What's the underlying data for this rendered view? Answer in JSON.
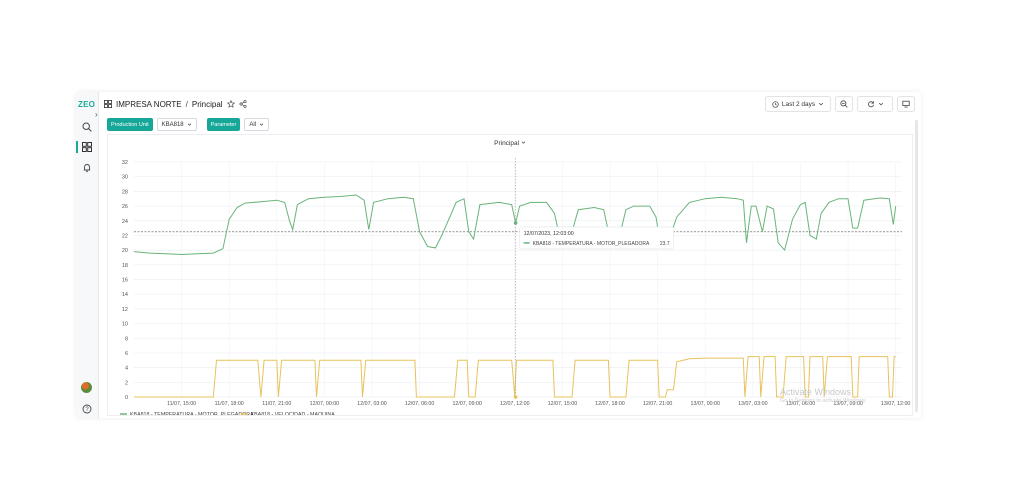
{
  "sidebar": {
    "logo": "ZEO",
    "expand_glyph": "›"
  },
  "header": {
    "dashboards_icon": "grid-icon",
    "title": "IMPRESA NORTE",
    "separator": "/",
    "page": "Principal",
    "time_range": "Last 2 days",
    "star_icon": "star-icon",
    "share_icon": "share-icon"
  },
  "filters": {
    "production_unit_label": "Production Unit",
    "production_unit_value": "KBA818",
    "parameter_label": "Parameter",
    "parameter_value": "All"
  },
  "panel": {
    "title": "Principal"
  },
  "tooltip": {
    "time": "12/07/2023, 12:03:00",
    "series": "KBA818 - TEMPERATURA - MOTOR_PLEGADORA",
    "value": "23.7"
  },
  "watermark": {
    "line1": "Activate Windows",
    "line2": "Go to Settings to activate Windows."
  },
  "chart_data": {
    "type": "line",
    "title": "Principal",
    "ylim": [
      0,
      32
    ],
    "yticks": [
      0,
      2,
      4,
      6,
      8,
      10,
      12,
      14,
      16,
      18,
      20,
      22,
      24,
      26,
      28,
      30,
      32
    ],
    "xticks": [
      "11/07, 15:00",
      "11/07, 18:00",
      "11/07, 21:00",
      "12/07, 00:00",
      "12/07, 03:00",
      "12/07, 06:00",
      "12/07, 09:00",
      "12/07, 12:00",
      "12/07, 15:00",
      "12/07, 18:00",
      "12/07, 21:00",
      "13/07, 00:00",
      "13/07, 03:00",
      "13/07, 06:00",
      "13/07, 09:00",
      "13/07, 12:00"
    ],
    "x_hours_from": "11/07, 12:00",
    "threshold": 22.5,
    "cursor_x": 24.05,
    "legend_position": "bottom-left",
    "grid": true,
    "series": [
      {
        "name": "KBA818 - TEMPERATURA - MOTOR_PLEGADORA",
        "color": "#6ab37a",
        "points": [
          [
            0,
            19.8
          ],
          [
            1,
            19.6
          ],
          [
            2,
            19.5
          ],
          [
            3,
            19.4
          ],
          [
            4,
            19.5
          ],
          [
            5,
            19.6
          ],
          [
            5.6,
            20.2
          ],
          [
            6,
            24.2
          ],
          [
            6.5,
            25.8
          ],
          [
            7,
            26.4
          ],
          [
            8,
            26.6
          ],
          [
            9,
            26.8
          ],
          [
            9.5,
            26.5
          ],
          [
            9.8,
            24.0
          ],
          [
            10.0,
            22.8
          ],
          [
            10.3,
            26.2
          ],
          [
            11,
            27.0
          ],
          [
            12,
            27.2
          ],
          [
            13,
            27.3
          ],
          [
            14,
            27.5
          ],
          [
            14.5,
            26.8
          ],
          [
            14.8,
            22.8
          ],
          [
            15.1,
            26.5
          ],
          [
            16,
            27.0
          ],
          [
            17,
            27.2
          ],
          [
            17.6,
            27.0
          ],
          [
            18,
            22.5
          ],
          [
            18.5,
            20.5
          ],
          [
            19,
            20.3
          ],
          [
            19.4,
            22.0
          ],
          [
            19.7,
            23.5
          ],
          [
            20.3,
            26.5
          ],
          [
            20.8,
            27.0
          ],
          [
            21.1,
            22.5
          ],
          [
            21.4,
            21.5
          ],
          [
            21.8,
            26.2
          ],
          [
            23,
            26.5
          ],
          [
            23.8,
            26.2
          ],
          [
            24.05,
            23.7
          ],
          [
            24.3,
            26.0
          ],
          [
            25,
            26.5
          ],
          [
            26,
            26.5
          ],
          [
            26.5,
            25.0
          ],
          [
            26.8,
            22.0
          ],
          [
            27.2,
            21.0
          ],
          [
            27.6,
            22.5
          ],
          [
            28,
            25.5
          ],
          [
            29,
            25.8
          ],
          [
            29.6,
            25.5
          ],
          [
            30,
            21.5
          ],
          [
            30.5,
            21.0
          ],
          [
            31,
            25.5
          ],
          [
            31.5,
            26.0
          ],
          [
            32.5,
            26.0
          ],
          [
            32.9,
            24.5
          ],
          [
            33.2,
            20.5
          ],
          [
            33.6,
            20.6
          ],
          [
            34.2,
            24.5
          ],
          [
            35,
            26.5
          ],
          [
            36,
            27.0
          ],
          [
            37,
            27.2
          ],
          [
            38,
            27.0
          ],
          [
            38.4,
            26.8
          ],
          [
            38.6,
            21.0
          ],
          [
            38.9,
            26.0
          ],
          [
            39.2,
            26.0
          ],
          [
            39.6,
            22.5
          ],
          [
            39.9,
            26.0
          ],
          [
            40.3,
            25.6
          ],
          [
            40.6,
            21.0
          ],
          [
            41,
            20.0
          ],
          [
            41.5,
            24.2
          ],
          [
            42,
            26.2
          ],
          [
            42.3,
            26.5
          ],
          [
            42.6,
            22.0
          ],
          [
            43,
            21.5
          ],
          [
            43.3,
            25.0
          ],
          [
            43.8,
            26.5
          ],
          [
            44.4,
            27.0
          ],
          [
            45,
            27.0
          ],
          [
            45.3,
            23.0
          ],
          [
            45.6,
            23.0
          ],
          [
            46,
            26.8
          ],
          [
            47,
            27.1
          ],
          [
            47.6,
            27.0
          ],
          [
            47.85,
            23.5
          ],
          [
            48,
            26.0
          ]
        ]
      },
      {
        "name": "KBA818 - VELOCIDAD - MAQUINA",
        "color": "#e8c35b",
        "points": [
          [
            0,
            0
          ],
          [
            4.9,
            0
          ],
          [
            5,
            0
          ],
          [
            5.2,
            5.0
          ],
          [
            7.8,
            5.0
          ],
          [
            8.0,
            0
          ],
          [
            8.2,
            5.0
          ],
          [
            9.0,
            5.0
          ],
          [
            9.1,
            0
          ],
          [
            9.3,
            5.0
          ],
          [
            11.4,
            5.0
          ],
          [
            11.5,
            0
          ],
          [
            11.7,
            5.0
          ],
          [
            14.3,
            5.0
          ],
          [
            14.4,
            0
          ],
          [
            14.6,
            5.0
          ],
          [
            17.7,
            5.0
          ],
          [
            17.8,
            0
          ],
          [
            20.2,
            0
          ],
          [
            20.4,
            5.0
          ],
          [
            21.0,
            5.0
          ],
          [
            21.1,
            0
          ],
          [
            21.5,
            0
          ],
          [
            21.7,
            5.0
          ],
          [
            23.8,
            5.0
          ],
          [
            24.0,
            0
          ],
          [
            24.1,
            5.0
          ],
          [
            26.4,
            5.0
          ],
          [
            26.5,
            0
          ],
          [
            27.6,
            0
          ],
          [
            27.8,
            5.0
          ],
          [
            29.9,
            5.0
          ],
          [
            30.0,
            0
          ],
          [
            31.0,
            0
          ],
          [
            31.2,
            5.0
          ],
          [
            33.0,
            5.0
          ],
          [
            33.1,
            0
          ],
          [
            33.5,
            0
          ],
          [
            33.6,
            1.0
          ],
          [
            34.0,
            1.0
          ],
          [
            34.2,
            4.8
          ],
          [
            35,
            5.2
          ],
          [
            36,
            5.3
          ],
          [
            37.3,
            5.3
          ],
          [
            38.4,
            5.3
          ],
          [
            38.5,
            0
          ],
          [
            38.7,
            5.5
          ],
          [
            39.4,
            5.5
          ],
          [
            39.5,
            0
          ],
          [
            39.7,
            5.5
          ],
          [
            40.4,
            5.5
          ],
          [
            40.5,
            0
          ],
          [
            40.9,
            0
          ],
          [
            41.1,
            5.5
          ],
          [
            42.2,
            5.5
          ],
          [
            42.3,
            0
          ],
          [
            42.5,
            0
          ],
          [
            42.6,
            5.5
          ],
          [
            43.4,
            5.5
          ],
          [
            43.5,
            0
          ],
          [
            43.7,
            5.5
          ],
          [
            45.2,
            5.5
          ],
          [
            45.3,
            0
          ],
          [
            45.6,
            0
          ],
          [
            45.7,
            5.5
          ],
          [
            47.5,
            5.5
          ],
          [
            47.6,
            0
          ],
          [
            47.8,
            0
          ],
          [
            47.9,
            5.5
          ],
          [
            48,
            5.5
          ]
        ]
      }
    ]
  }
}
